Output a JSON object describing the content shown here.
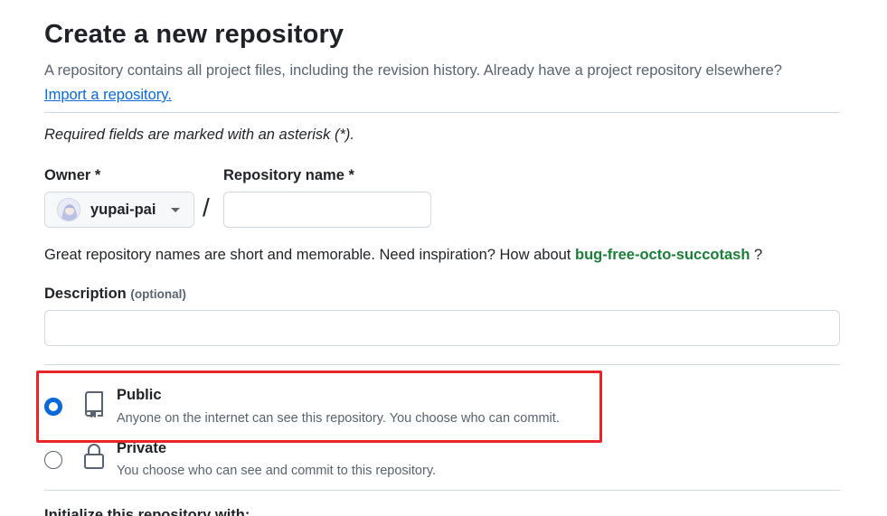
{
  "header": {
    "title": "Create a new repository",
    "subtitle": "A repository contains all project files, including the revision history. Already have a project repository elsewhere?",
    "import_link": "Import a repository."
  },
  "form": {
    "required_note": "Required fields are marked with an asterisk (*).",
    "owner_label": "Owner *",
    "owner_value": "yupai-pai",
    "separator": "/",
    "repo_name_label": "Repository name *",
    "repo_name_value": "",
    "suggestion_prefix": "Great repository names are short and memorable. Need inspiration? How about",
    "suggestion_name": "bug-free-octo-succotash",
    "suggestion_suffix": "?",
    "description_label": "Description",
    "description_optional": "(optional)",
    "description_value": ""
  },
  "visibility": {
    "public": {
      "title": "Public",
      "description": "Anyone on the internet can see this repository. You choose who can commit.",
      "selected": true,
      "icon": "repo-icon"
    },
    "private": {
      "title": "Private",
      "description": "You choose who can see and commit to this repository.",
      "selected": false,
      "icon": "lock-icon"
    }
  },
  "cut_off_heading": "Initialize this repository with:",
  "colors": {
    "link": "#0969da",
    "suggestion": "#1a7f37",
    "highlight": "#e8262a",
    "radio_selected": "#0969da"
  }
}
